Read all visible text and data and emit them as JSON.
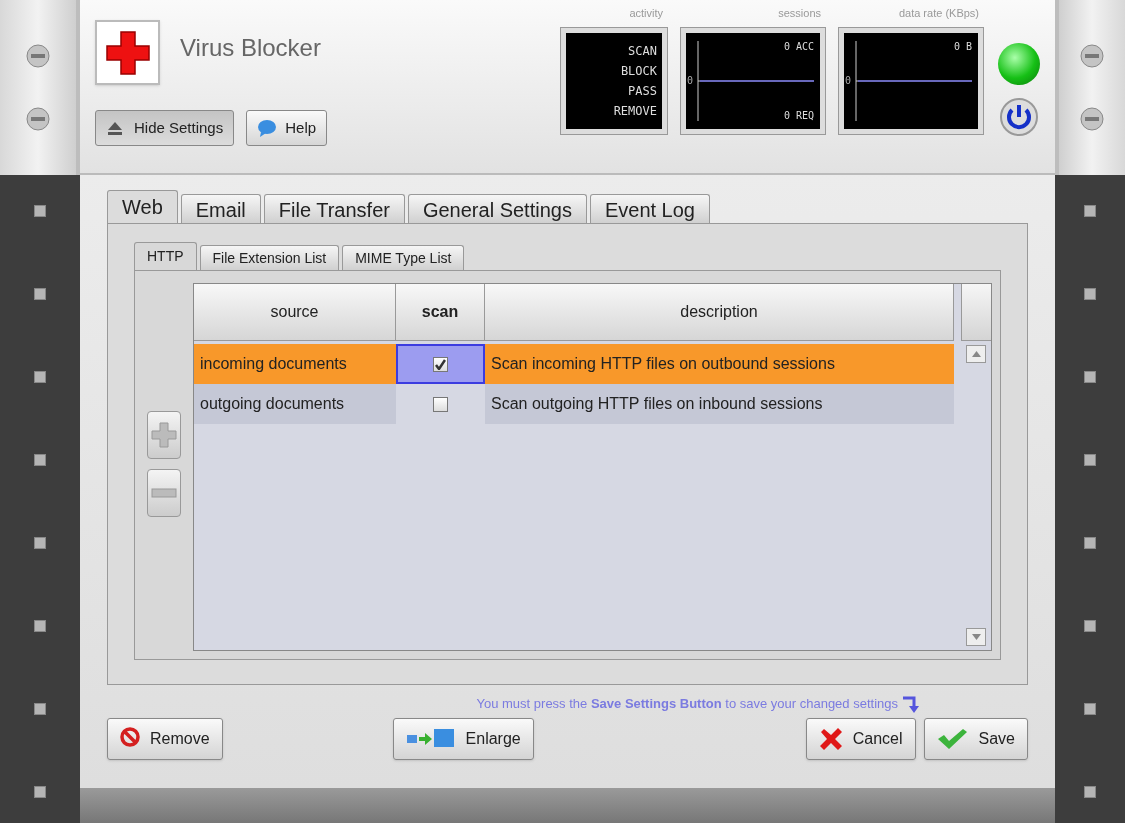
{
  "header": {
    "title": "Virus Blocker",
    "running": true,
    "buttons": [
      {
        "label": "Hide Settings",
        "kind": "hide"
      },
      {
        "label": "Help",
        "kind": "help"
      }
    ],
    "monitors": [
      {
        "kind": "list",
        "label": "activity",
        "items": [
          "SCAN",
          "BLOCK",
          "PASS",
          "REMOVE"
        ]
      },
      {
        "kind": "graph",
        "label": "sessions",
        "axis_label": "0",
        "top": "0 ACC",
        "bottom": "0 REQ"
      },
      {
        "kind": "graph",
        "label": "data rate (KBps)",
        "axis_label": "0",
        "top": "0 B"
      }
    ]
  },
  "tabs": [
    {
      "label": "Web",
      "selected": true
    },
    {
      "label": "Email",
      "selected": false
    },
    {
      "label": "File Transfer",
      "selected": false
    },
    {
      "label": "General Settings",
      "selected": false
    },
    {
      "label": "Event Log",
      "selected": false
    }
  ],
  "subtabs": [
    {
      "label": "HTTP",
      "selected": true
    },
    {
      "label": "File Extension List",
      "selected": false
    },
    {
      "label": "MIME Type List",
      "selected": false
    }
  ],
  "table": {
    "columns": [
      "source",
      "scan",
      "description"
    ],
    "rows": [
      {
        "source": "incoming documents",
        "checked": true,
        "description": "Scan incoming HTTP files on outbound sessions",
        "selected": true
      },
      {
        "source": "outgoing documents",
        "checked": false,
        "description": "Scan outgoing HTTP files on inbound sessions",
        "selected": false
      }
    ]
  },
  "message": "You must press the **Save Settings Button** to save your changed settings",
  "buttons": [
    {
      "label": "Remove",
      "kind": "remove"
    },
    {
      "label": "Enlarge",
      "kind": "enlarge"
    },
    {
      "label": "Cancel",
      "kind": "cancel"
    },
    {
      "label": "Save",
      "kind": "save"
    }
  ]
}
